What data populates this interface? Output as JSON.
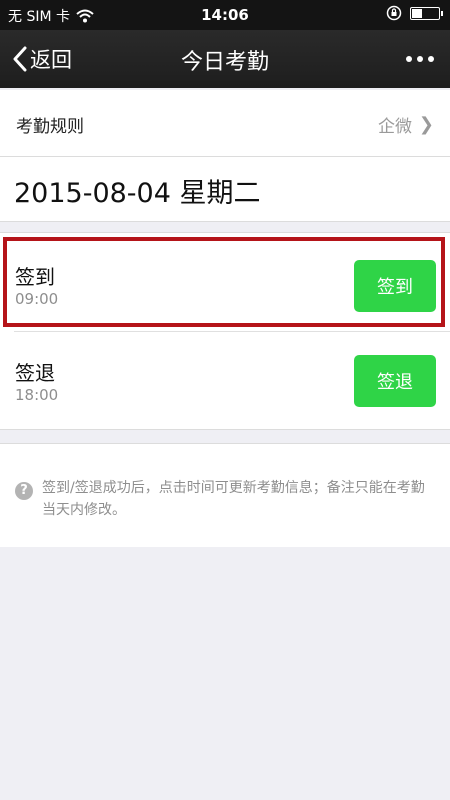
{
  "status_bar": {
    "carrier": "无 SIM 卡",
    "time": "14:06"
  },
  "nav": {
    "back_label": "返回",
    "title": "今日考勤",
    "more_icon": "more-dots-icon"
  },
  "rules": {
    "label": "考勤规则",
    "value": "企微"
  },
  "date": {
    "text": "2015-08-04 星期二"
  },
  "attendance": [
    {
      "label": "签到",
      "time": "09:00",
      "button_label": "签到",
      "highlighted": true
    },
    {
      "label": "签退",
      "time": "18:00",
      "button_label": "签退",
      "highlighted": false
    }
  ],
  "info": {
    "text": "签到/签退成功后，点击时间可更新考勤信息；备注只能在考勤当天内修改。"
  },
  "colors": {
    "button_green": "#2fd447",
    "highlight_red": "#b51419",
    "nav_bg": "#1e1e1e"
  },
  "battery_level": 0.4
}
